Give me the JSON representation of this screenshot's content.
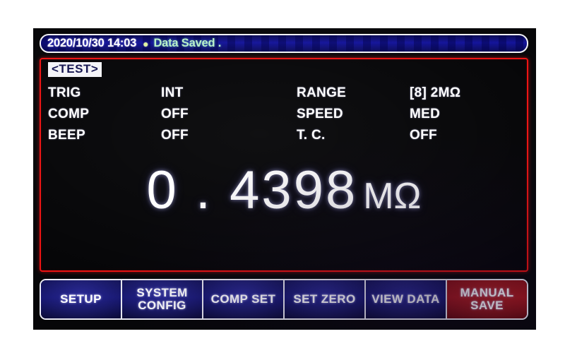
{
  "status_bar": {
    "datetime": "2020/10/30  14:03",
    "bullet": "●",
    "message": "Data  Saved ."
  },
  "main_panel": {
    "mode_badge": "<TEST>",
    "parameters": [
      {
        "label": "TRIG",
        "value": "INT",
        "label2": "RANGE",
        "value2": "[8]  2MΩ"
      },
      {
        "label": "COMP",
        "value": "OFF",
        "label2": "SPEED",
        "value2": "MED"
      },
      {
        "label": "BEEP",
        "value": "OFF",
        "label2": "T. C.",
        "value2": "OFF"
      }
    ],
    "reading": {
      "value": "0 . 4398",
      "unit": "MΩ"
    }
  },
  "button_bar": {
    "buttons": [
      {
        "label": "SETUP",
        "active": false
      },
      {
        "label": "SYSTEM\nCONFIG",
        "active": false
      },
      {
        "label": "COMP SET",
        "active": false
      },
      {
        "label": "SET ZERO",
        "active": false
      },
      {
        "label": "VIEW DATA",
        "active": false
      },
      {
        "label": "MANUAL\nSAVE",
        "active": true
      }
    ]
  },
  "colors": {
    "screen_background": "#060608",
    "panel_border_red": "#ee1111",
    "status_blue": "#1414a0",
    "button_blue": "#101062",
    "button_active_red": "#9c1018",
    "text_white": "#ffffff",
    "status_message_green": "#b9f0c8",
    "badge_background": "#f4f4f8",
    "badge_text": "#141450"
  }
}
